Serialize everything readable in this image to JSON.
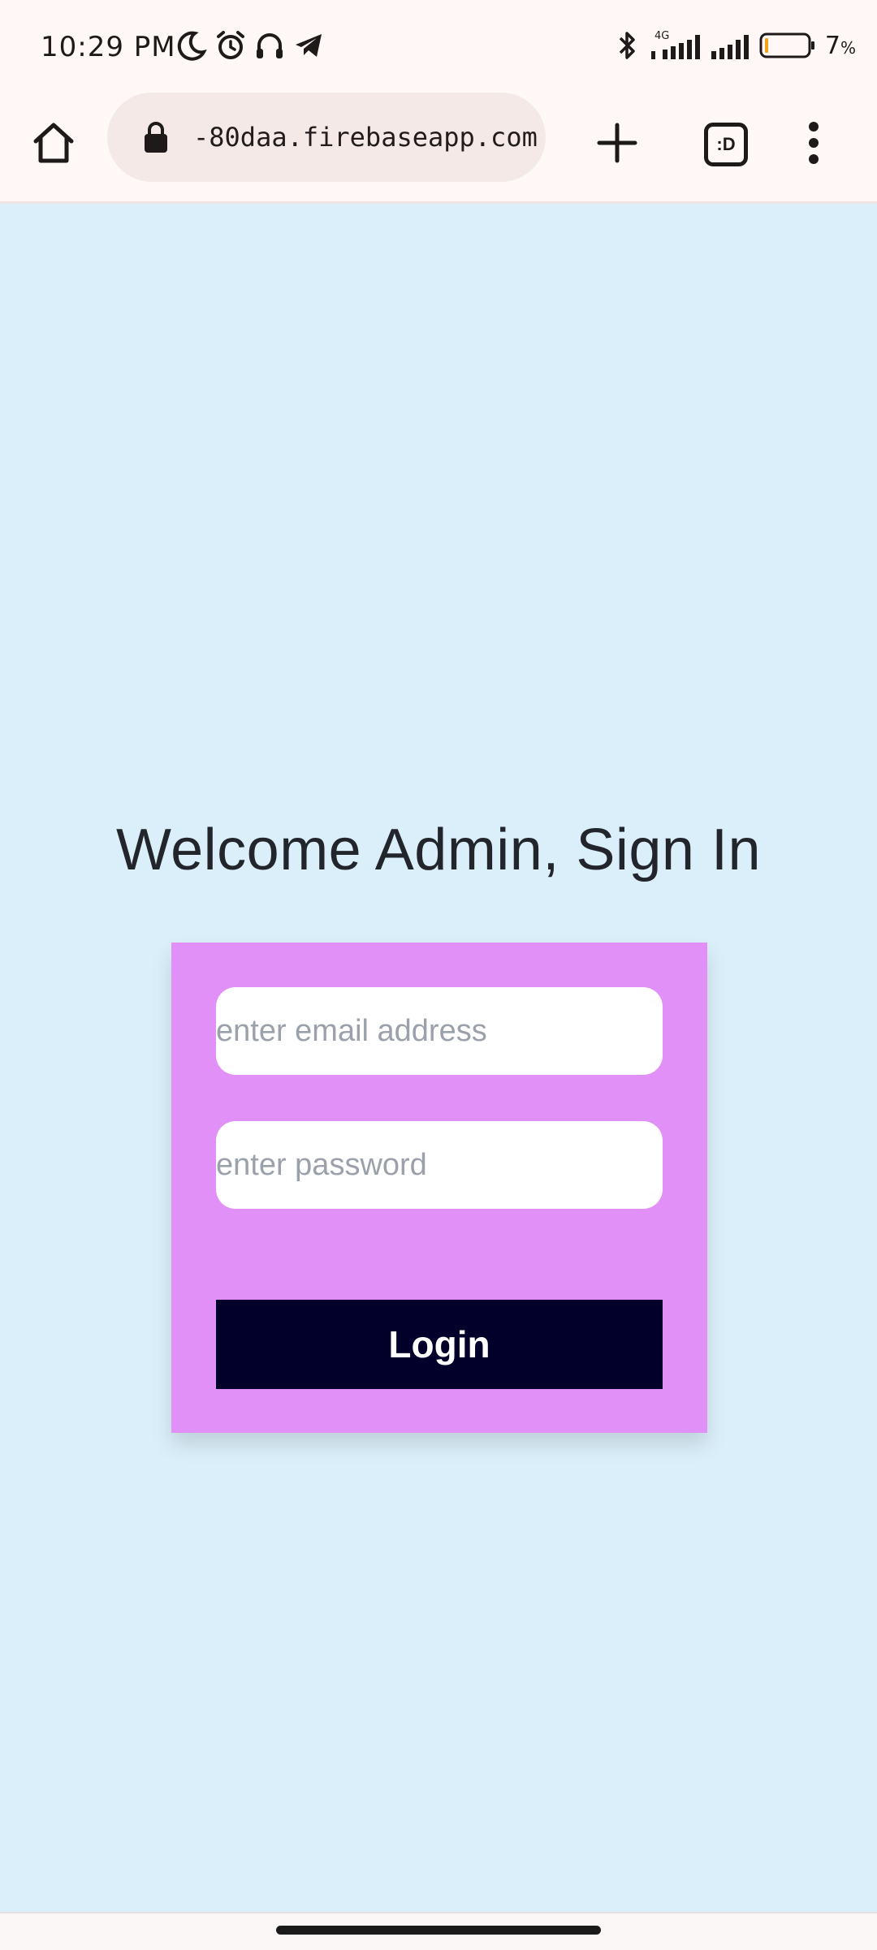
{
  "status_bar": {
    "time": "10:29 PM",
    "battery_percent": "7",
    "battery_unit": "%",
    "network_type": "4G",
    "icons_left": [
      "moon-icon",
      "alarm-icon",
      "headphones-icon",
      "telegram-icon"
    ],
    "icons_right": [
      "bluetooth-icon",
      "signal-icon",
      "signal-icon",
      "battery-icon"
    ]
  },
  "browser": {
    "url": "-80daa.firebaseapp.com",
    "tab_count_label": ":D",
    "icons": [
      "home-icon",
      "lock-icon",
      "plus-icon",
      "tabs-icon",
      "more-vert-icon"
    ]
  },
  "page": {
    "title": "Welcome Admin, Sign In",
    "email_placeholder": "enter email address",
    "password_placeholder": "enter password",
    "login_label": "Login"
  },
  "colors": {
    "page_background": "#dbeffa",
    "card_background": "#e190f7",
    "login_button": "#02002b",
    "browser_chrome": "#fff8f6"
  }
}
